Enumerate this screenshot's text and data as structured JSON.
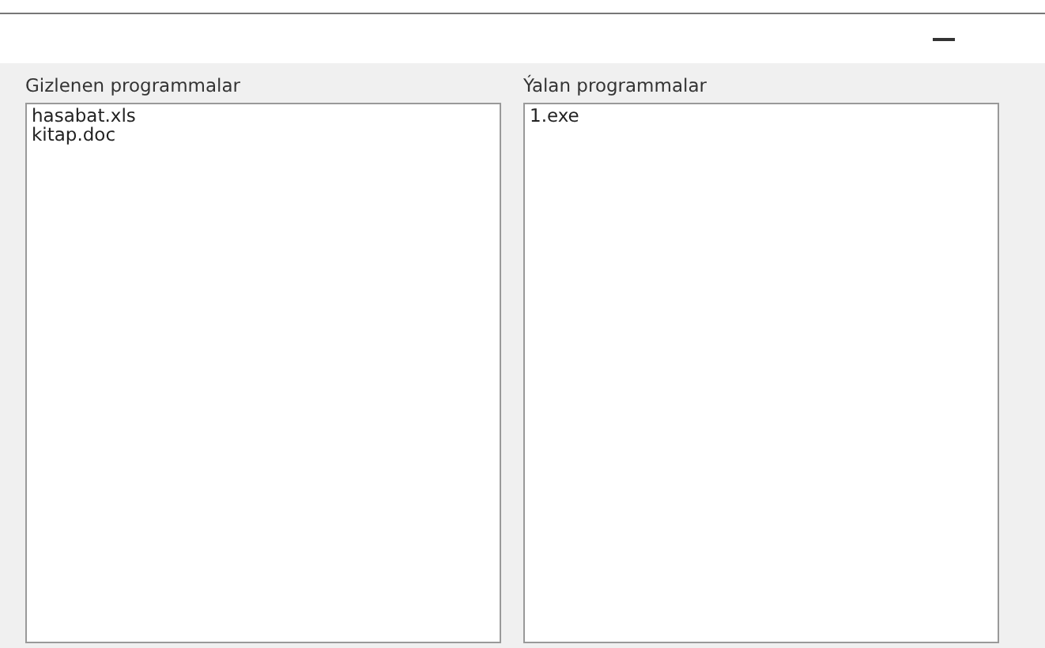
{
  "lists": [
    {
      "label": "Gizlenen programmalar",
      "items": [
        "hasabat.xls",
        "kitap.doc"
      ]
    },
    {
      "label": "Ýalan programmalar",
      "items": [
        "1.exe"
      ]
    }
  ]
}
